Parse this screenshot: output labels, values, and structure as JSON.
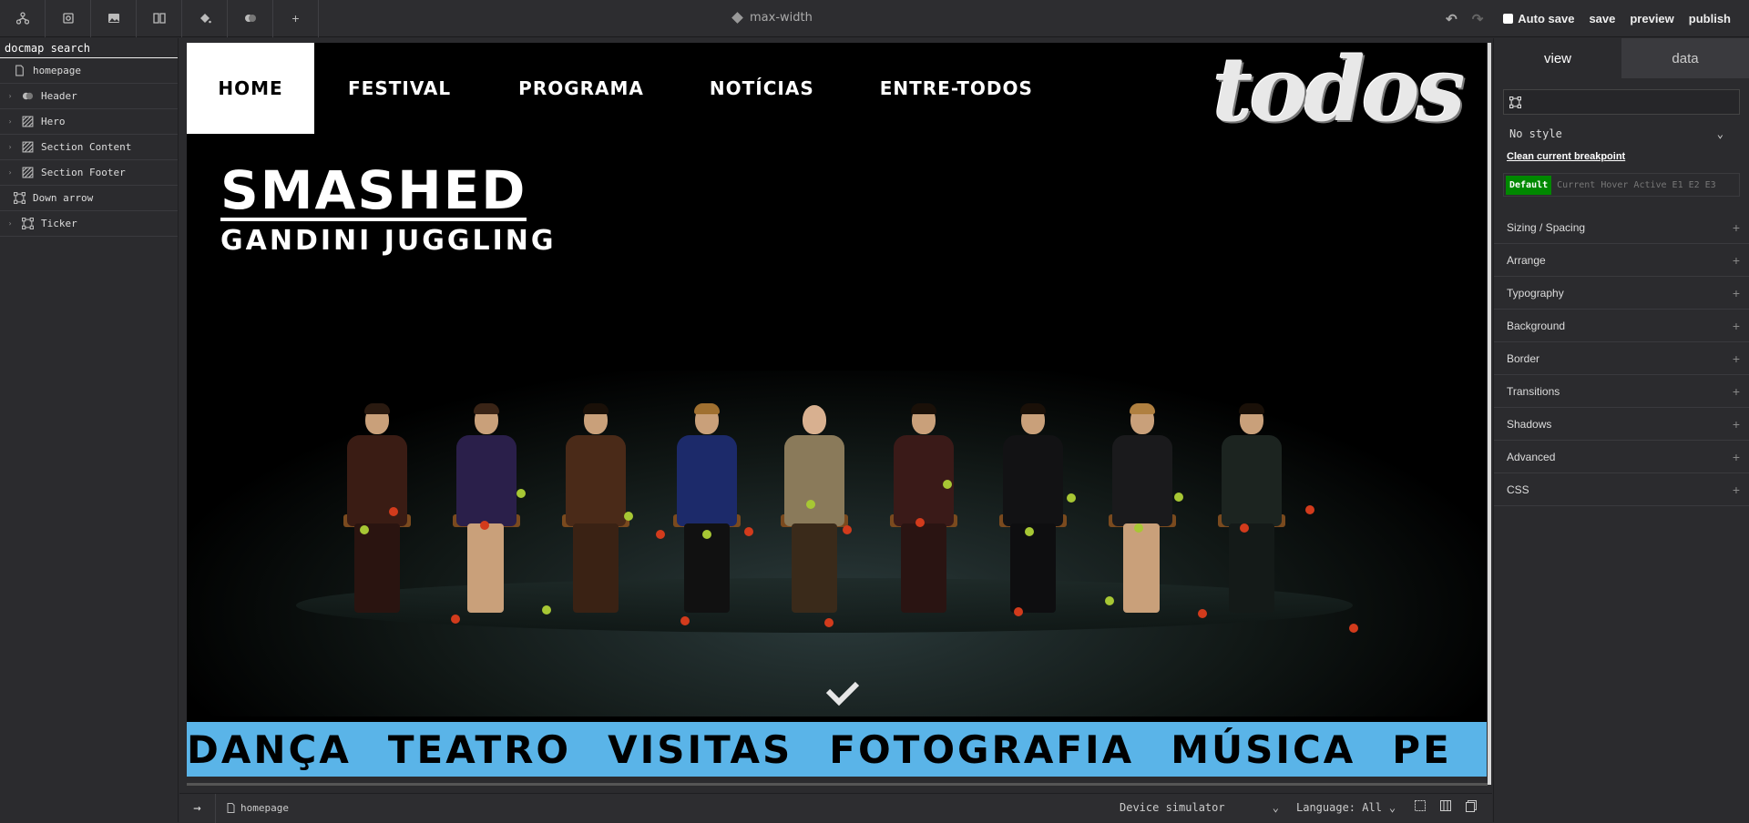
{
  "topbar": {
    "tools": [
      "sitemap-icon",
      "component-icon",
      "image-icon",
      "book-icon",
      "paint-bucket-icon",
      "toggle-icon",
      "plus-icon"
    ],
    "plus_label": "+",
    "title": "max-width",
    "autosave_label": "Auto save",
    "save_label": "save",
    "preview_label": "preview",
    "publish_label": "publish"
  },
  "docmap": {
    "search_placeholder": "docmap search",
    "items": [
      {
        "label": "homepage",
        "icon": "page-icon",
        "expandable": false
      },
      {
        "label": "Header",
        "icon": "toggle-icon",
        "expandable": true
      },
      {
        "label": "Hero",
        "icon": "hatched-box-icon",
        "expandable": true
      },
      {
        "label": "Section Content",
        "icon": "hatched-box-icon",
        "expandable": true
      },
      {
        "label": "Section Footer",
        "icon": "hatched-box-icon",
        "expandable": true
      },
      {
        "label": "Down arrow",
        "icon": "frame-icon",
        "expandable": false
      },
      {
        "label": "Ticker",
        "icon": "frame-icon",
        "expandable": true
      }
    ]
  },
  "site": {
    "nav": [
      "HOME",
      "FESTIVAL",
      "PROGRAMA",
      "NOTÍCIAS",
      "ENTRE-TODOS"
    ],
    "logo": "todos",
    "hero_title": "SMASHED",
    "hero_subtitle": "GANDINI JUGGLING",
    "ticker": [
      "DANÇA",
      "TEATRO",
      "VISITAS",
      "FOTOGRAFIA",
      "MÚSICA",
      "PE"
    ],
    "ticker_color": "#5ab4e8"
  },
  "bottombar": {
    "page": "homepage",
    "device": "Device simulator",
    "language": "Language: All"
  },
  "inspector": {
    "tabs": [
      "view",
      "data"
    ],
    "style_select": "No style",
    "clean_label": "Clean current breakpoint",
    "states": [
      "Default",
      "Current",
      "Hover",
      "Active",
      "E1",
      "E2",
      "E3"
    ],
    "sections": [
      "Sizing / Spacing",
      "Arrange",
      "Typography",
      "Background",
      "Border",
      "Transitions",
      "Shadows",
      "Advanced",
      "CSS"
    ]
  }
}
